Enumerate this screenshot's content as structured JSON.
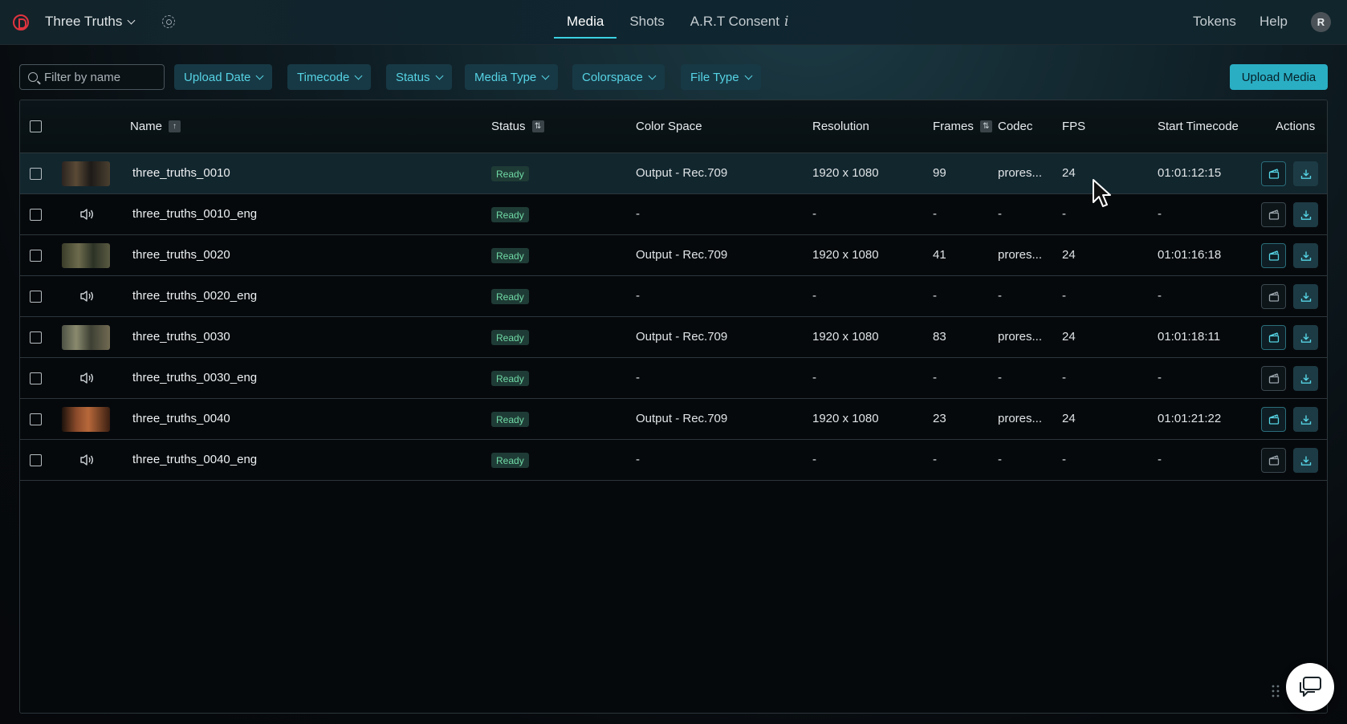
{
  "app": {
    "project_name": "Three Truths",
    "brand_color": "#e0343f",
    "accent_color": "#2aaec4"
  },
  "nav": {
    "tabs": [
      {
        "label": "Media",
        "active": true
      },
      {
        "label": "Shots",
        "active": false
      },
      {
        "label": "A.R.T Consent",
        "active": false
      }
    ],
    "info_glyph": "i",
    "tokens": "Tokens",
    "help": "Help",
    "avatar_initial": "R"
  },
  "filters": {
    "search_placeholder": "Filter by name",
    "search_value": "",
    "dropdowns": [
      "Upload Date",
      "Timecode",
      "Status",
      "Media Type",
      "Colorspace",
      "File Type"
    ],
    "upload_button": "Upload Media"
  },
  "table": {
    "columns": {
      "name": "Name",
      "status": "Status",
      "color_space": "Color Space",
      "resolution": "Resolution",
      "frames": "Frames",
      "codec": "Codec",
      "fps": "FPS",
      "start_timecode": "Start Timecode",
      "actions": "Actions"
    },
    "rows": [
      {
        "name": "three_truths_0010",
        "kind": "video",
        "status": "Ready",
        "color_space": "Output - Rec.709",
        "resolution": "1920 x 1080",
        "frames": "99",
        "codec": "prores...",
        "fps": "24",
        "start_timecode": "01:01:12:15",
        "highlighted": true
      },
      {
        "name": "three_truths_0010_eng",
        "kind": "audio",
        "status": "Ready",
        "color_space": "-",
        "resolution": "-",
        "frames": "-",
        "codec": "-",
        "fps": "-",
        "start_timecode": "-",
        "highlighted": false
      },
      {
        "name": "three_truths_0020",
        "kind": "video",
        "status": "Ready",
        "color_space": "Output - Rec.709",
        "resolution": "1920 x 1080",
        "frames": "41",
        "codec": "prores...",
        "fps": "24",
        "start_timecode": "01:01:16:18",
        "highlighted": false
      },
      {
        "name": "three_truths_0020_eng",
        "kind": "audio",
        "status": "Ready",
        "color_space": "-",
        "resolution": "-",
        "frames": "-",
        "codec": "-",
        "fps": "-",
        "start_timecode": "-",
        "highlighted": false
      },
      {
        "name": "three_truths_0030",
        "kind": "video",
        "status": "Ready",
        "color_space": "Output - Rec.709",
        "resolution": "1920 x 1080",
        "frames": "83",
        "codec": "prores...",
        "fps": "24",
        "start_timecode": "01:01:18:11",
        "highlighted": false
      },
      {
        "name": "three_truths_0030_eng",
        "kind": "audio",
        "status": "Ready",
        "color_space": "-",
        "resolution": "-",
        "frames": "-",
        "codec": "-",
        "fps": "-",
        "start_timecode": "-",
        "highlighted": false
      },
      {
        "name": "three_truths_0040",
        "kind": "video",
        "status": "Ready",
        "color_space": "Output - Rec.709",
        "resolution": "1920 x 1080",
        "frames": "23",
        "codec": "prores...",
        "fps": "24",
        "start_timecode": "01:01:21:22",
        "highlighted": false
      },
      {
        "name": "three_truths_0040_eng",
        "kind": "audio",
        "status": "Ready",
        "color_space": "-",
        "resolution": "-",
        "frames": "-",
        "codec": "-",
        "fps": "-",
        "start_timecode": "-",
        "highlighted": false
      }
    ]
  },
  "icons": {
    "row_action_1": "clapperboard-icon",
    "row_action_2": "download-icon",
    "audio": "speaker-icon",
    "chat": "chat-icon"
  }
}
